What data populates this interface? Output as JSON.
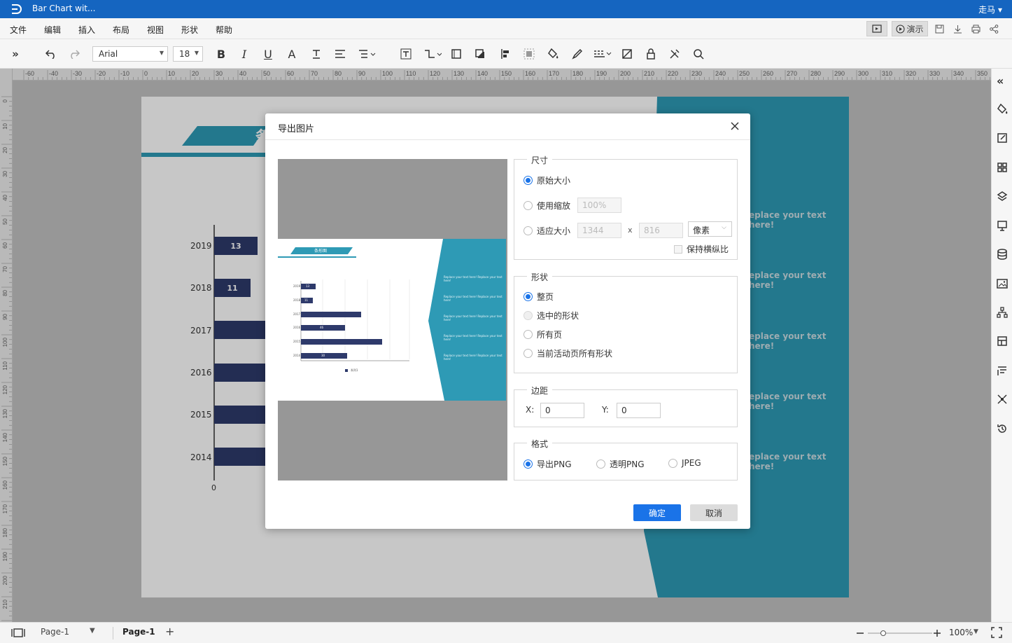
{
  "app": {
    "doc_title": "Bar Chart wit...",
    "user": "走马 ▾"
  },
  "menu": [
    "文件",
    "编辑",
    "插入",
    "布局",
    "视图",
    "形状",
    "帮助"
  ],
  "menubar_right": {
    "present": "演示"
  },
  "toolbar": {
    "font": "Arial",
    "size": "18"
  },
  "ruler": {
    "h_labels": [
      "-60",
      "-40",
      "-30",
      "-20",
      "-10",
      "0",
      "10",
      "20",
      "30",
      "40",
      "50",
      "60",
      "70",
      "80",
      "90",
      "100",
      "110",
      "120",
      "130",
      "140",
      "150",
      "160",
      "170",
      "180",
      "190",
      "200",
      "210",
      "220",
      "230",
      "240",
      "250",
      "260",
      "270",
      "280",
      "290",
      "300",
      "310",
      "320",
      "330",
      "340",
      "350"
    ],
    "v_labels": [
      "0",
      "10",
      "20",
      "30",
      "40",
      "50",
      "60",
      "70",
      "80",
      "90",
      "100",
      "110",
      "120",
      "130",
      "140",
      "150",
      "160",
      "170",
      "180",
      "190",
      "200",
      "210",
      "220"
    ]
  },
  "chart": {
    "title": "条",
    "years": [
      "2019",
      "2018",
      "2017",
      "2016",
      "2015",
      "2014"
    ],
    "values": [
      "13",
      "11",
      "",
      "",
      "",
      ""
    ],
    "x0": "0"
  },
  "teal_panel": {
    "texts": [
      "eplace your text here!",
      "eplace your text here!",
      "eplace your text here!",
      "eplace your text here!",
      "eplace your text here!"
    ]
  },
  "dialog": {
    "title": "导出图片",
    "size": {
      "legend": "尺寸",
      "original": "原始大小",
      "zoom": "使用缩放",
      "zoom_val": "100%",
      "fit": "适应大小",
      "w": "1344",
      "x": "x",
      "h": "816",
      "unit": "像素",
      "keep_ratio": "保持横纵比"
    },
    "shape": {
      "legend": "形状",
      "opts": [
        "整页",
        "选中的形状",
        "所有页",
        "当前活动页所有形状"
      ]
    },
    "margin": {
      "legend": "边距",
      "x_label": "X:",
      "x_val": "0",
      "y_label": "Y:",
      "y_val": "0"
    },
    "format": {
      "legend": "格式",
      "opts": [
        "导出PNG",
        "透明PNG",
        "JPEG"
      ]
    },
    "ok": "确定",
    "cancel": "取消"
  },
  "preview": {
    "title": "条形图",
    "labels": [
      "2019",
      "2018",
      "2017",
      "2016",
      "2015",
      "2014"
    ],
    "values": [
      "13",
      "11",
      "",
      "46",
      "",
      "30"
    ],
    "teal_texts": [
      "Replace your text here!  Replace your text here!",
      "Replace your text here!  Replace your text here!",
      "Replace your text here!  Replace your text here!",
      "Replace your text here!  Replace your text here!",
      "Replace your text here!  Replace your text here!"
    ],
    "legend": "系列1"
  },
  "status": {
    "page_sel": "Page-1",
    "page_tab": "Page-1",
    "add": "+",
    "zoom": "100%"
  }
}
